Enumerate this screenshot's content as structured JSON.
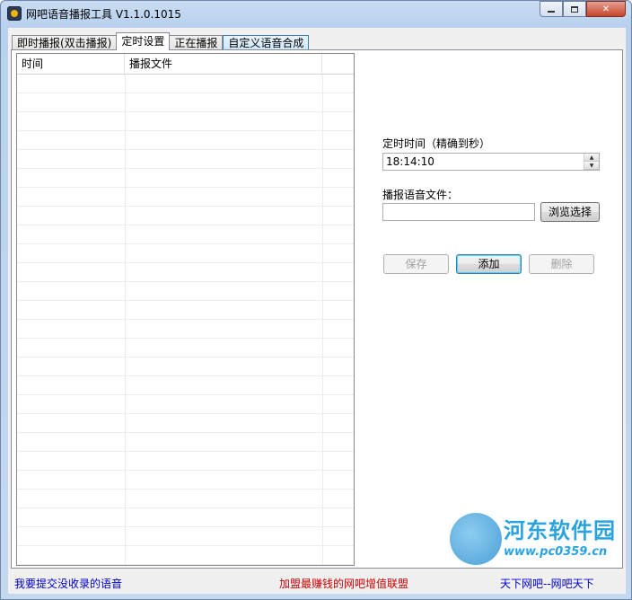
{
  "window": {
    "title": "网吧语音播报工具 V1.1.0.1015"
  },
  "tabs": [
    {
      "label": "即时播报(双击播报)",
      "active": false
    },
    {
      "label": "定时设置",
      "active": true
    },
    {
      "label": "正在播报",
      "active": false
    },
    {
      "label": "自定义语音合成",
      "active": false
    }
  ],
  "list": {
    "columns": [
      "时间",
      "播报文件",
      ""
    ],
    "rows": []
  },
  "form": {
    "time_label": "定时时间（精确到秒）",
    "time_value": "18:14:10",
    "file_label": "播报语音文件：",
    "file_value": "",
    "browse_label": "浏览选择",
    "save_label": "保存",
    "add_label": "添加",
    "delete_label": "删除"
  },
  "footer": {
    "left_link": "我要提交没收录的语音",
    "center_link": "加盟最赚钱的网吧增值联盟",
    "right_link": "天下网吧--网吧天下"
  },
  "watermark": {
    "name": "河东软件园",
    "url": "www.pc0359.cn"
  },
  "colors": {
    "left_link": "#0000cc",
    "center_link": "#cc0000",
    "right_link": "#0000cc",
    "watermark": "#2aa3df"
  },
  "icons": [
    "app-icon",
    "minimize-icon",
    "maximize-icon",
    "close-icon",
    "spin-up-icon",
    "spin-down-icon"
  ]
}
